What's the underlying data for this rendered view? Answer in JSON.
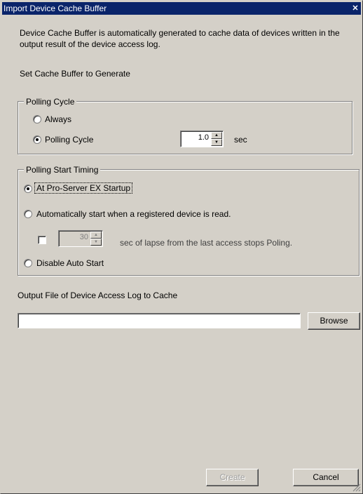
{
  "window": {
    "title": "Import Device Cache Buffer"
  },
  "description": "Device Cache Buffer is automatically generated to cache data of devices written in the output result of the device access log.",
  "section_label": "Set Cache Buffer to Generate",
  "polling_cycle_group": {
    "legend": "Polling Cycle",
    "option_always": "Always",
    "option_polling": "Polling Cycle",
    "selected": "Polling Cycle",
    "value": "1.0",
    "unit": "sec"
  },
  "polling_start_group": {
    "legend": "Polling Start Timing",
    "option_startup": "At Pro-Server EX Startup",
    "option_auto": "Automatically start when a registered device is read.",
    "option_disable": "Disable Auto Start",
    "selected": "At Pro-Server EX Startup",
    "lapse_checked": false,
    "lapse_value": "30",
    "lapse_text": "sec of lapse from the last access stops Poling."
  },
  "output_file": {
    "label": "Output File of Device Access Log to Cache",
    "value": "",
    "browse_label": "Browse"
  },
  "footer": {
    "create_label": "Create",
    "cancel_label": "Cancel"
  }
}
